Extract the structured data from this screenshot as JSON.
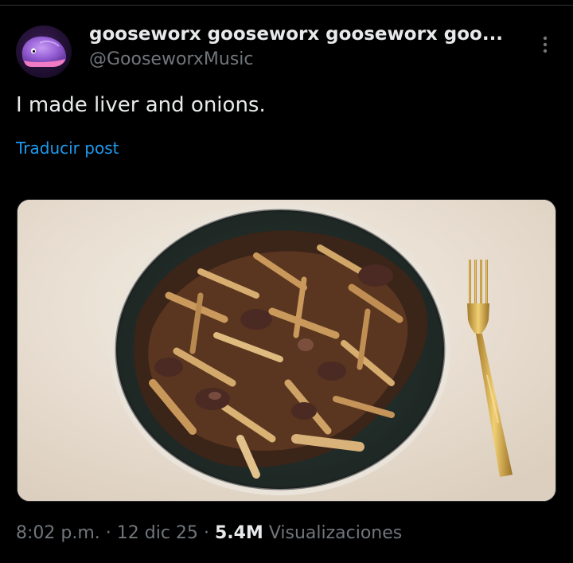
{
  "tweet": {
    "display_name": "gooseworx gooseworx gooseworx goo...",
    "handle": "@GooseworxMusic",
    "text": "I made liver and onions.",
    "translate_label": "Traducir post",
    "media_alt": "Liver and onions on a dark plate with a gold fork",
    "time": "8:02 p.m.",
    "separator": "·",
    "date": "12 dic 25",
    "views_count": "5.4M",
    "views_label": "Visualizaciones"
  },
  "icons": {
    "avatar": "purple-whale-avatar",
    "more": "more-options-icon"
  },
  "colors": {
    "background": "#000000",
    "primary_text": "#e7e9ea",
    "secondary_text": "#71767b",
    "link": "#1d9bf0",
    "divider": "#2f3336"
  }
}
